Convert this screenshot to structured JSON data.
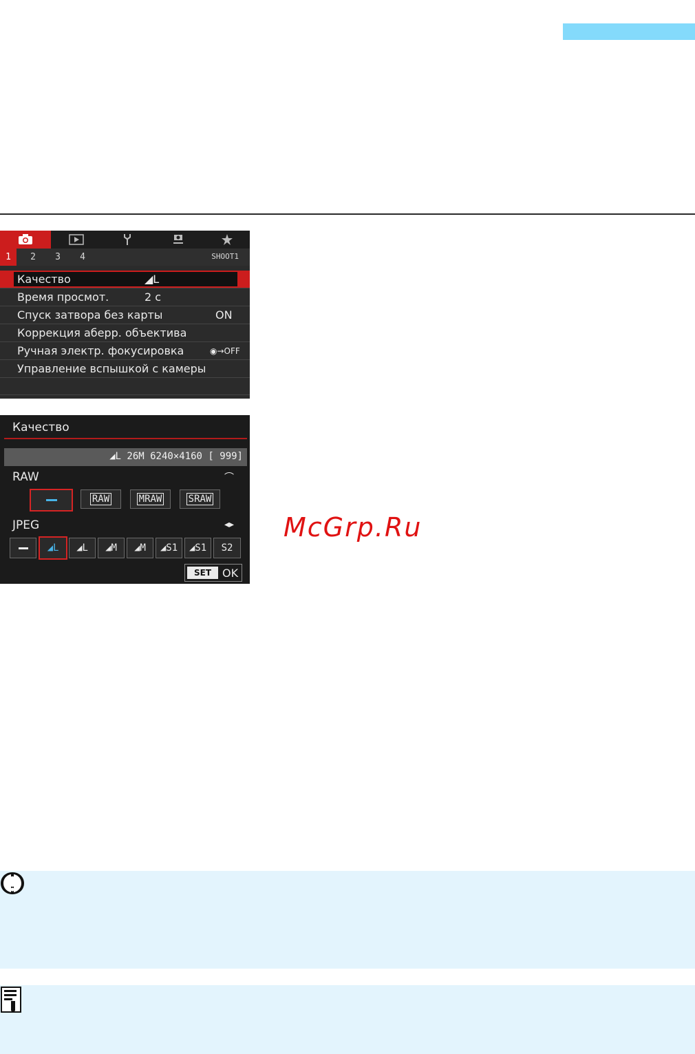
{
  "menu": {
    "tabs": [
      "camera-icon",
      "play-icon",
      "wrench-icon",
      "custom-icon",
      "star-icon"
    ],
    "subtabs": [
      "1",
      "2",
      "3",
      "4"
    ],
    "shoot_label": "SHOOT1",
    "rows": [
      {
        "label": "Качество",
        "value": "◢L"
      },
      {
        "label": "Время просмот.",
        "value": "2 с"
      },
      {
        "label": "Спуск затвора без карты",
        "value": "ON"
      },
      {
        "label": "Коррекция аберр. объектива",
        "value": ""
      },
      {
        "label": "Ручная электр. фокусировка",
        "value": "◉→OFF"
      },
      {
        "label": "Управление вспышкой с камеры",
        "value": ""
      }
    ],
    "accent": "#cc1d1d"
  },
  "quality": {
    "title": "Качество",
    "info": "◢L  26M 6240×4160 [ 999]",
    "raw_label": "RAW",
    "raw_options": [
      "—",
      "RAW",
      "MRAW",
      "SRAW"
    ],
    "jpeg_label": "JPEG",
    "jpeg_options": [
      "—",
      "◢L",
      "◢L",
      "◢M",
      "◢M",
      "◢S1",
      "◢S1",
      "S2"
    ],
    "set_label": "SET",
    "ok_label": "OK",
    "selection_color": "#d62424",
    "highlight_color": "#48b4e8"
  },
  "watermark": "McGrp.Ru",
  "colors": {
    "header_bar": "#84dafb",
    "note_bg": "#e3f4fd"
  }
}
